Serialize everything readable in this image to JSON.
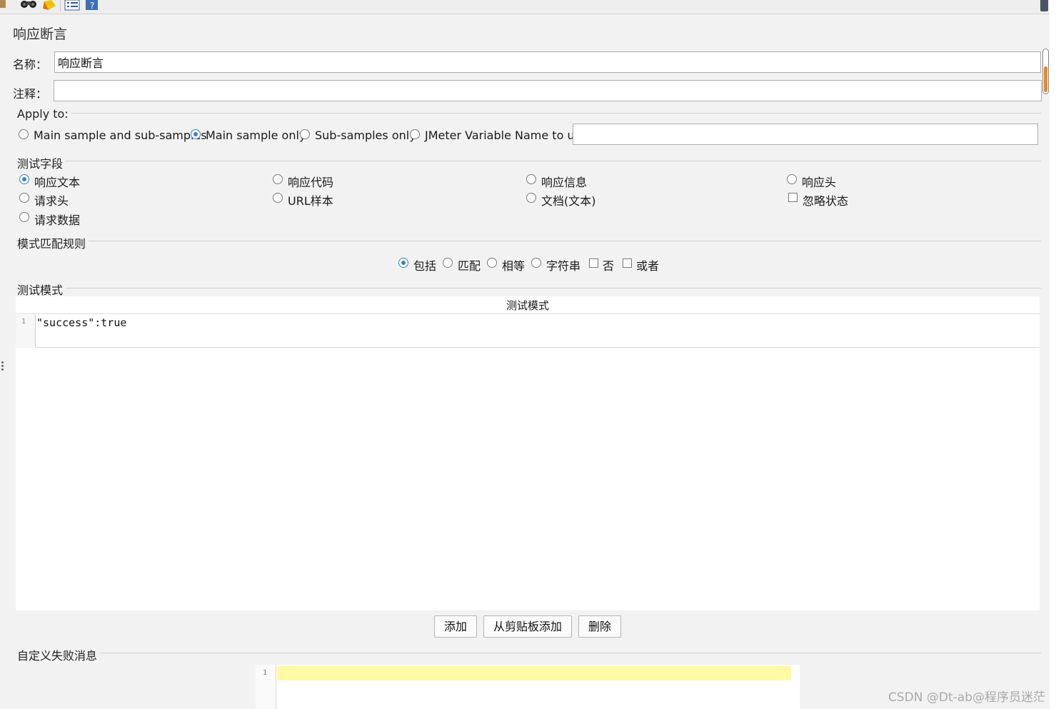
{
  "title": "响应断言",
  "name_label": "名称：",
  "name_value": "响应断言",
  "comment_label": "注释：",
  "comment_value": "",
  "apply_to": {
    "title": "Apply to:",
    "options": [
      "Main sample and sub-samples",
      "Main sample only",
      "Sub-samples only",
      "JMeter Variable Name to use"
    ],
    "selected": "Main sample only",
    "variable_value": ""
  },
  "test_field": {
    "title": "测试字段",
    "options": [
      "响应文本",
      "响应代码",
      "响应信息",
      "响应头",
      "请求头",
      "URL样本",
      "文档(文本)",
      "忽略状态",
      "请求数据"
    ],
    "selected": "响应文本",
    "ignore_status_checked": false
  },
  "match_rules": {
    "title": "模式匹配规则",
    "options": [
      "包括",
      "匹配",
      "相等",
      "字符串",
      "否",
      "或者"
    ],
    "selected": "包括",
    "not_checked": false,
    "or_checked": false
  },
  "patterns": {
    "title": "测试模式",
    "column_header": "测试模式",
    "line_number": "1",
    "value": "\"success\":true"
  },
  "buttons": {
    "add": "添加",
    "add_from_clipboard": "从剪贴板添加",
    "delete": "删除"
  },
  "failure_message": {
    "title": "自定义失败消息",
    "line_number": "1",
    "value": ""
  },
  "watermark": "CSDN @Dt-ab@程序员迷茫",
  "colors": {
    "panel_bg": "#f2f2f2",
    "radio_selected": "#3f7fc6",
    "editor_highlight": "#fffaa3",
    "scroll_thumb": "#e8892b"
  }
}
